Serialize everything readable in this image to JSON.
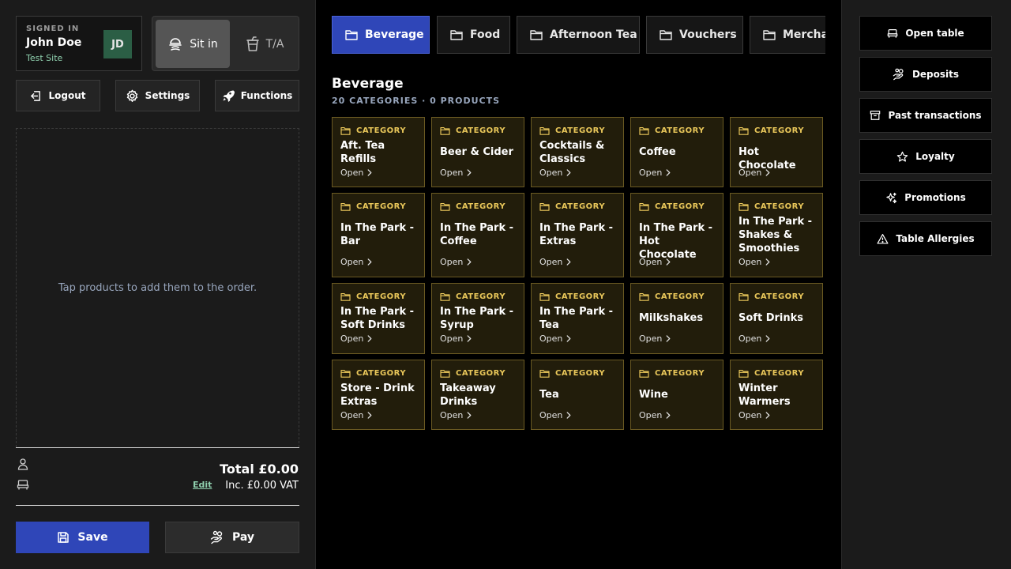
{
  "user": {
    "signed_in_label": "SIGNED IN",
    "name": "John Doe",
    "site": "Test Site",
    "initials": "JD"
  },
  "mode": {
    "sit_in": "Sit in",
    "takeaway": "T/A",
    "active": "sit_in"
  },
  "toolbar": {
    "logout": "Logout",
    "settings": "Settings",
    "functions": "Functions"
  },
  "order": {
    "empty_message": "Tap products to add them to the order.",
    "edit": "Edit",
    "total": "Total £0.00",
    "vat": "Inc. £0.00 VAT",
    "save": "Save",
    "pay": "Pay"
  },
  "tabs": [
    {
      "label": "Beverage",
      "active": true
    },
    {
      "label": "Food"
    },
    {
      "label": "Afternoon Tea"
    },
    {
      "label": "Vouchers"
    },
    {
      "label": "Merchandise"
    }
  ],
  "section": {
    "title": "Beverage",
    "subtitle": "20 CATEGORIES · 0 PRODUCTS"
  },
  "card_labels": {
    "kicker": "CATEGORY",
    "open": "Open"
  },
  "categories": [
    {
      "name": "Aft. Tea Refills"
    },
    {
      "name": "Beer & Cider"
    },
    {
      "name": "Cocktails & Classics"
    },
    {
      "name": "Coffee"
    },
    {
      "name": "Hot Chocolate"
    },
    {
      "name": "In The Park - Bar"
    },
    {
      "name": "In The Park - Coffee"
    },
    {
      "name": "In The Park - Extras"
    },
    {
      "name": "In The Park - Hot Chocolate"
    },
    {
      "name": "In The Park - Shakes & Smoothies"
    },
    {
      "name": "In The Park - Soft Drinks"
    },
    {
      "name": "In The Park - Syrup"
    },
    {
      "name": "In The Park - Tea"
    },
    {
      "name": "Milkshakes"
    },
    {
      "name": "Soft Drinks"
    },
    {
      "name": "Store - Drink Extras"
    },
    {
      "name": "Takeaway Drinks"
    },
    {
      "name": "Tea"
    },
    {
      "name": "Wine"
    },
    {
      "name": "Winter Warmers"
    }
  ],
  "actions": {
    "open_table": "Open table",
    "deposits": "Deposits",
    "past_transactions": "Past transactions",
    "loyalty": "Loyalty",
    "promotions": "Promotions",
    "table_allergies": "Table Allergies"
  },
  "colors": {
    "accent_blue": "#2f46b8",
    "category_bg": "#221d0b",
    "category_border": "#6b5a22",
    "category_kicker": "#e9c75a",
    "site_green": "#8fd0ae"
  }
}
